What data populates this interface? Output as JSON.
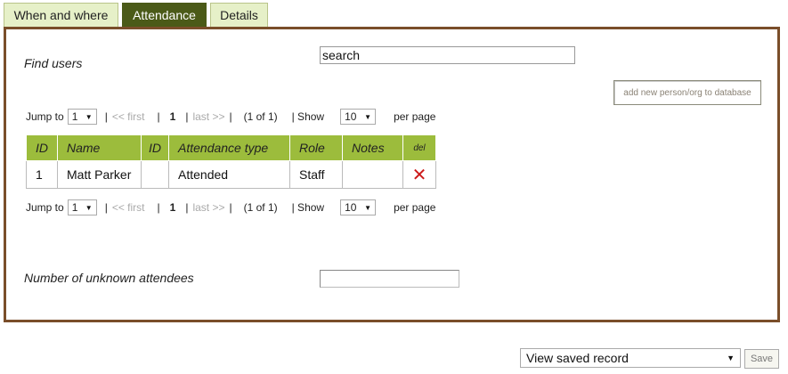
{
  "tabs": [
    {
      "label": "When and where",
      "active": false
    },
    {
      "label": "Attendance",
      "active": true
    },
    {
      "label": "Details",
      "active": false
    }
  ],
  "find_users": {
    "label": "Find users",
    "search_value": "search"
  },
  "add_button_label": "add new person/org to database",
  "pager": {
    "jump_to": "Jump to",
    "page_value": "1",
    "first": "<< first",
    "current": "1",
    "last": "last >>",
    "page_of": "(1 of 1)",
    "show": "| Show",
    "show_value": "10",
    "per_page": "per page"
  },
  "table": {
    "headers": [
      "ID",
      "Name",
      "ID",
      "Attendance type",
      "Role",
      "Notes",
      "del"
    ],
    "rows": [
      {
        "id": "1",
        "name": "Matt Parker",
        "id2": "",
        "attendance_type": "Attended",
        "role": "Staff",
        "notes": ""
      }
    ]
  },
  "unknown_attendees": {
    "label": "Number of unknown attendees",
    "value": ""
  },
  "bottom": {
    "select_value": "View saved record",
    "save_label": "Save"
  },
  "colors": {
    "active_tab": "#4b5a18",
    "inactive_tab": "#e6f0c8",
    "header_green": "#9cbc3c",
    "panel_border": "#7a4e2a",
    "delete_red": "#cc1a1a"
  }
}
